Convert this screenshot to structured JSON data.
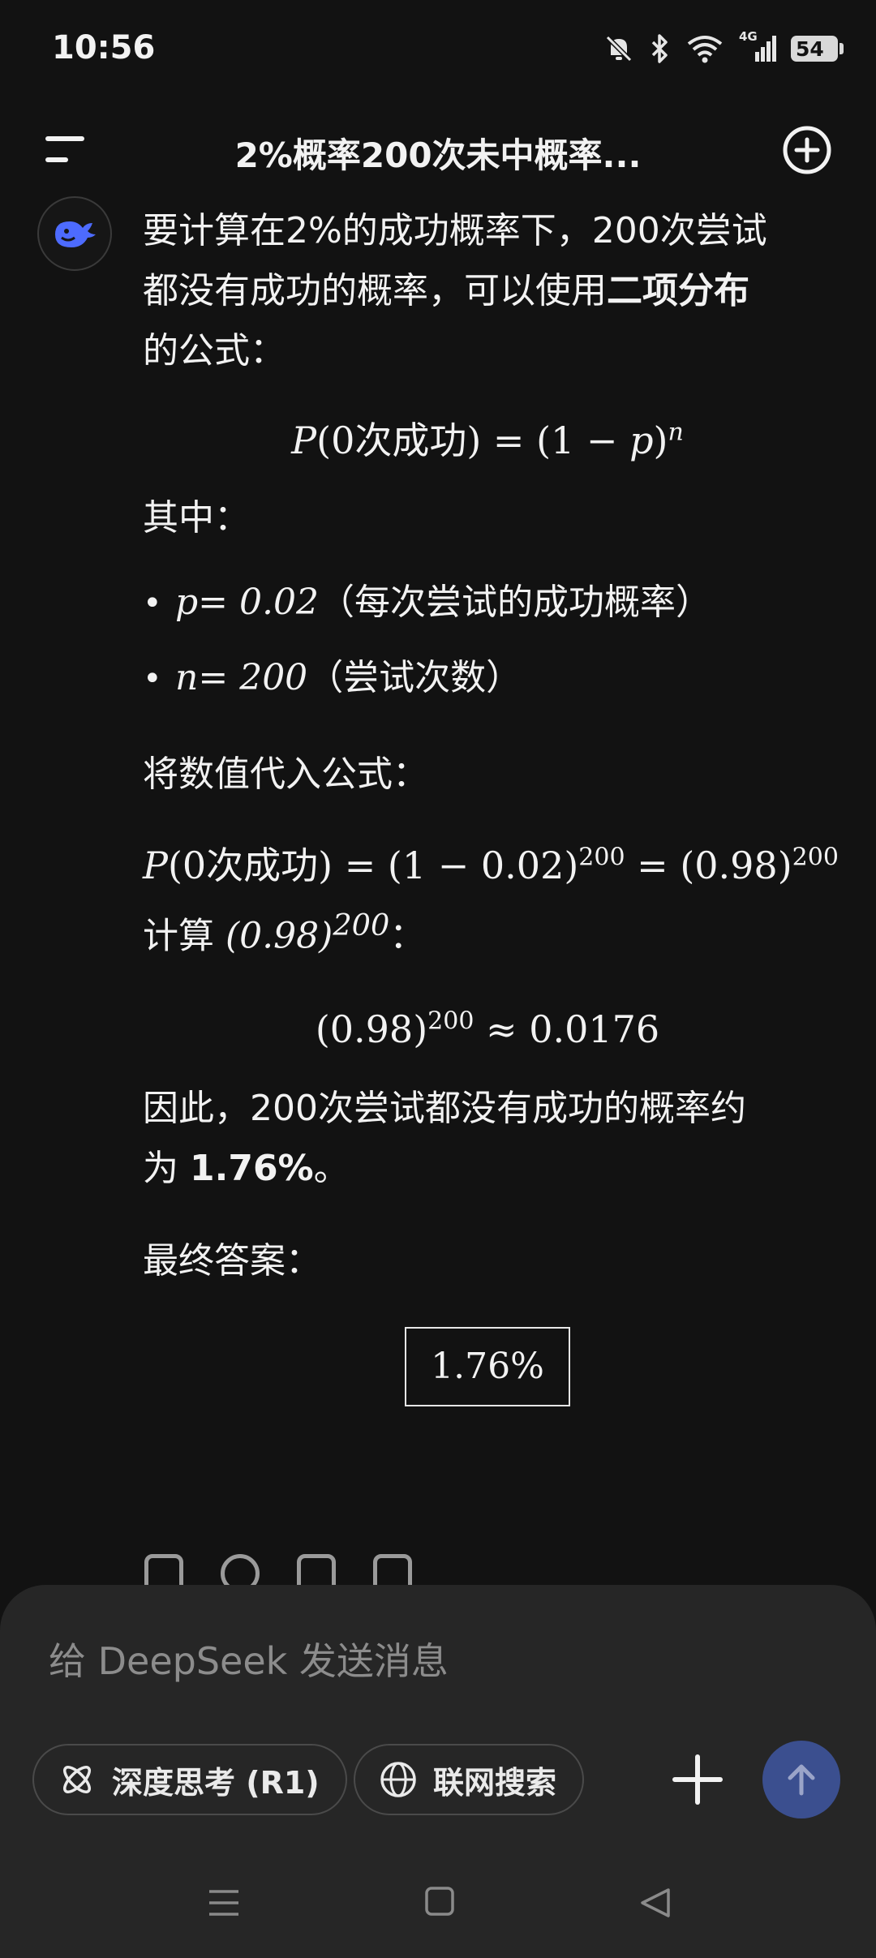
{
  "status_bar": {
    "time": "10:56",
    "network": "4G",
    "battery": "54",
    "icons": [
      "mute-bell-icon",
      "bluetooth-icon",
      "wifi-icon",
      "signal-icon",
      "battery-icon"
    ]
  },
  "header": {
    "title": "2%概率200次未中概率...",
    "menu_icon": "menu-icon",
    "new_chat_icon": "new-chat-icon"
  },
  "message": {
    "intro_line1": "要计算在2%的成功概率下，200次尝试",
    "intro_line2_pre": "都没有成功的概率，可以使用",
    "intro_bold": "二项分布",
    "intro_line3": "的公式：",
    "formula_general": {
      "lhs_var": "P",
      "lhs_open": "(0",
      "lhs_text": "次成功",
      "lhs_close": ")",
      "rhs": "= (1 − ",
      "rhs_var": "p",
      "rhs_close": ")",
      "exp": "n"
    },
    "where_label": "其中：",
    "bullets": [
      {
        "var": "p",
        "eq": " = 0.02",
        "desc": "（每次尝试的成功概率）"
      },
      {
        "var": "n",
        "eq": " = 200",
        "desc": "（尝试次数）"
      }
    ],
    "substitute_label": "将数值代入公式：",
    "formula_sub": {
      "lhs_var": "P",
      "lhs_open": "(0",
      "lhs_text": "次成功",
      "lhs_close": ")",
      "mid": " = (1 − 0.02)",
      "exp1": "200",
      "mid2": " = (0.98)",
      "exp2": "200"
    },
    "compute_label": "计算 ",
    "compute_base": "(0.98)",
    "compute_exp": "200",
    "compute_colon": "：",
    "approx_base": "(0.98)",
    "approx_exp": "200",
    "approx_rest": " ≈ 0.0176",
    "conclusion_line1": "因此，200次尝试都没有成功的概率约",
    "conclusion_pre": "为 ",
    "conclusion_bold": "1.76%",
    "conclusion_post": "。",
    "final_label": "最终答案：",
    "final_answer": "1.76%"
  },
  "composer": {
    "placeholder": "给 DeepSeek 发送消息",
    "deep_think_label": "深度思考 (R1)",
    "web_search_label": "联网搜索",
    "send_color": "#3b4f8f"
  }
}
